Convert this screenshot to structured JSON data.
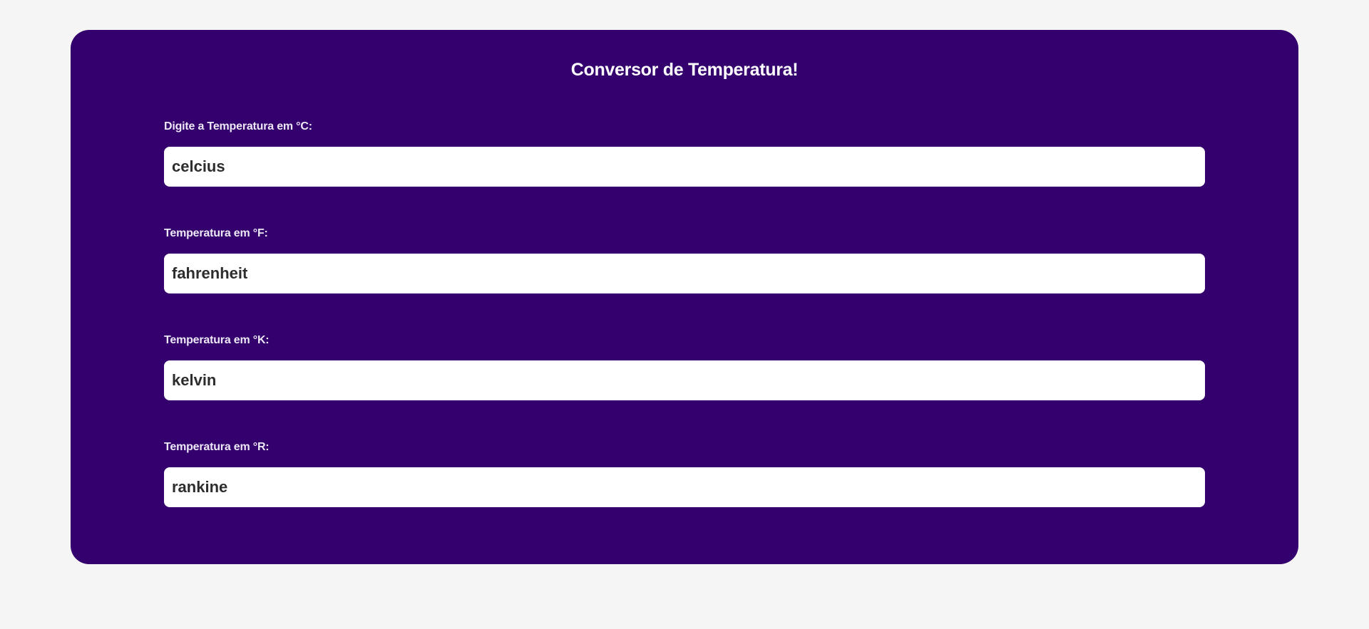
{
  "app": {
    "title": "Conversor de Temperatura!"
  },
  "fields": [
    {
      "label": "Digite a Temperatura em °C:",
      "placeholder": "celcius"
    },
    {
      "label": "Temperatura em °F:",
      "placeholder": "fahrenheit"
    },
    {
      "label": "Temperatura em °K:",
      "placeholder": "kelvin"
    },
    {
      "label": "Temperatura em °R:",
      "placeholder": "rankine"
    }
  ],
  "colors": {
    "page_background": "#f5f5f5",
    "card_background": "#33006e",
    "label_text": "#ece8f5",
    "input_background": "#ffffff",
    "input_text": "#2d2d2d"
  }
}
